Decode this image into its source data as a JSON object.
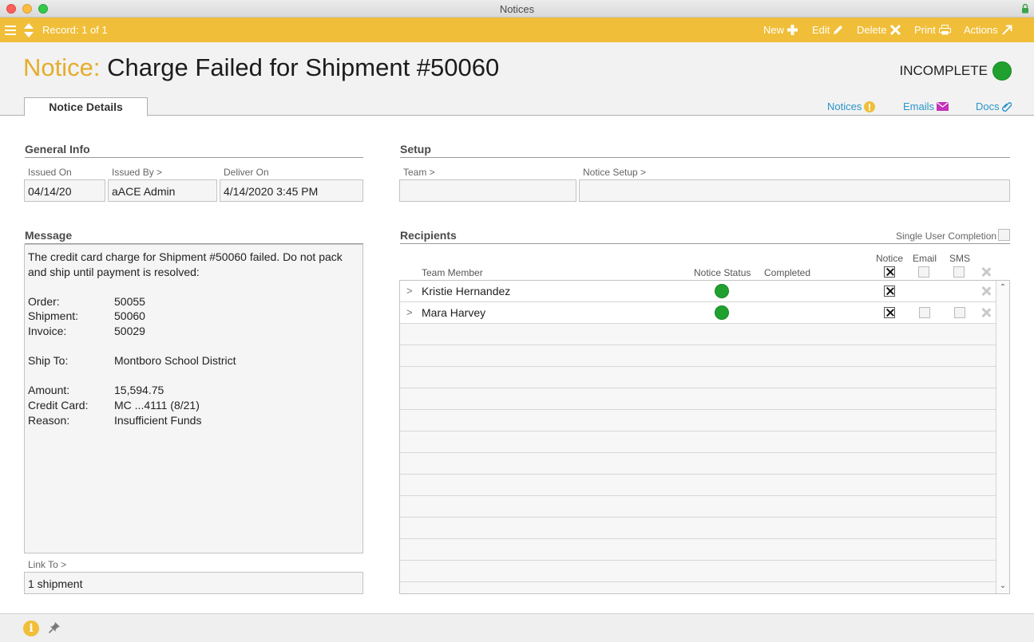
{
  "window": {
    "title": "Notices"
  },
  "toolbar": {
    "record": "Record: 1 of 1",
    "new": "New",
    "edit": "Edit",
    "delete": "Delete",
    "print": "Print",
    "actions": "Actions",
    "color": "#f0be38"
  },
  "header": {
    "title_prefix": "Notice:",
    "title": "Charge Failed for Shipment #50060",
    "status": "INCOMPLETE",
    "status_color": "#20a12f",
    "tab": "Notice Details",
    "links": {
      "notices": "Notices",
      "emails": "Emails",
      "docs": "Docs"
    }
  },
  "general_info": {
    "heading": "General Info",
    "issued_on_label": "Issued On",
    "issued_on": "04/14/20",
    "issued_by_label": "Issued By >",
    "issued_by": "aACE Admin",
    "deliver_on_label": "Deliver On",
    "deliver_on": "4/14/2020 3:45 PM"
  },
  "setup": {
    "heading": "Setup",
    "team_label": "Team >",
    "team": "",
    "notice_setup_label": "Notice Setup >",
    "notice_setup": ""
  },
  "message": {
    "heading": "Message",
    "intro": "The credit card charge for Shipment #50060 failed. Do not pack and ship until payment is resolved:",
    "rows": [
      {
        "k": "Order:",
        "v": "50055"
      },
      {
        "k": "Shipment:",
        "v": "50060"
      },
      {
        "k": "Invoice:",
        "v": "50029"
      },
      {
        "k": "Ship To:",
        "v": "Montboro School District"
      },
      {
        "k": "Amount:",
        "v": "15,594.75"
      },
      {
        "k": "Credit Card:",
        "v": "MC ...4111 (8/21)"
      },
      {
        "k": "Reason:",
        "v": "Insufficient Funds"
      }
    ],
    "link_to_label": "Link To >",
    "link_to": "1 shipment"
  },
  "recipients": {
    "heading": "Recipients",
    "single_user_completion": "Single User Completion",
    "columns": {
      "team_member": "Team Member",
      "notice_status": "Notice Status",
      "completed": "Completed",
      "notice": "Notice",
      "email": "Email",
      "sms": "SMS"
    },
    "rows": [
      {
        "name": "Kristie Hernandez",
        "status": "complete",
        "notice": true,
        "email": false,
        "sms": false
      },
      {
        "name": "Mara Harvey",
        "status": "complete",
        "notice": true,
        "email": false,
        "sms": false
      }
    ]
  }
}
